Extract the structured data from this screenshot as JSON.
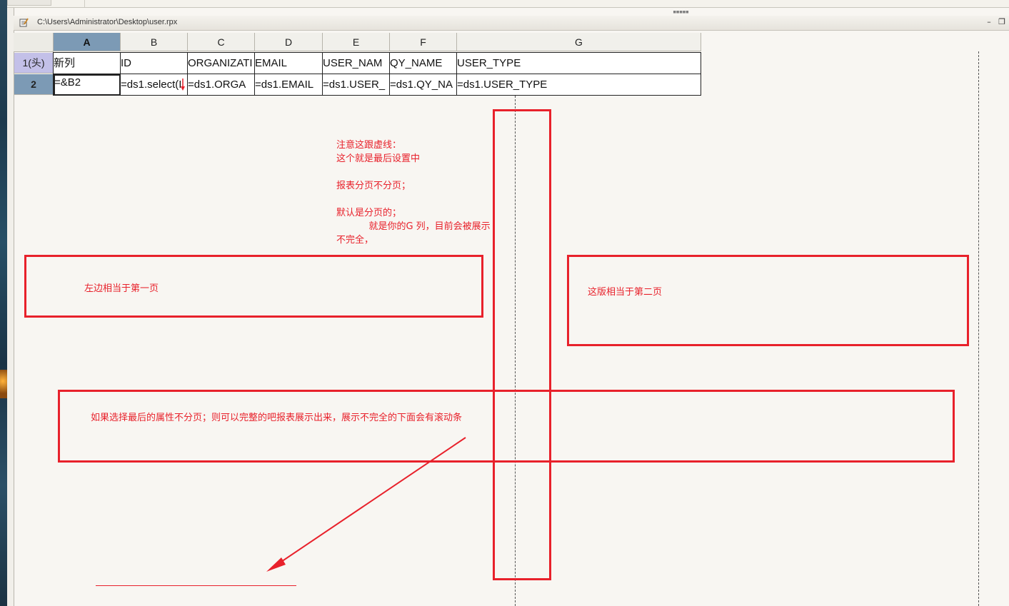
{
  "window": {
    "title": "C:\\Users\\Administrator\\Desktop\\user.rpx",
    "minimize_icon": "minimize-icon",
    "restore_icon": "restore-icon"
  },
  "grid": {
    "columns": [
      "A",
      "B",
      "C",
      "D",
      "E",
      "F",
      "G"
    ],
    "selected_column": "A",
    "rows": [
      {
        "header": "1(头)",
        "cells": [
          "新列",
          "ID",
          "ORGANIZATI",
          "EMAIL",
          "USER_NAM",
          "QY_NAME",
          "USER_TYPE"
        ]
      },
      {
        "header": "2",
        "cells": [
          "=&B2",
          "=ds1.select(I",
          "=ds1.ORGA",
          "=ds1.EMAIL",
          "=ds1.USER_",
          "=ds1.QY_NA",
          "=ds1.USER_TYPE"
        ]
      }
    ]
  },
  "annotations": {
    "dashed_note": "注意这跟虚线：\n这个就是最后设置中\n\n报表分页不分页；\n\n默认是分页的；\n           就是你的G 列，目前会被展示\n不完全，",
    "page_one": "左边相当于第一页",
    "page_two": "这版相当于第二页",
    "no_paging_note": "如果选择最后的属性不分页；则可以完整的吧报表展示出来，展示不完全的下面会有滚动条"
  },
  "colors": {
    "annotation_red": "#e8212b",
    "selected_header": "#7c9ab5",
    "row1_header": "#c3c0e8",
    "canvas_bg": "#f8f6f2"
  }
}
